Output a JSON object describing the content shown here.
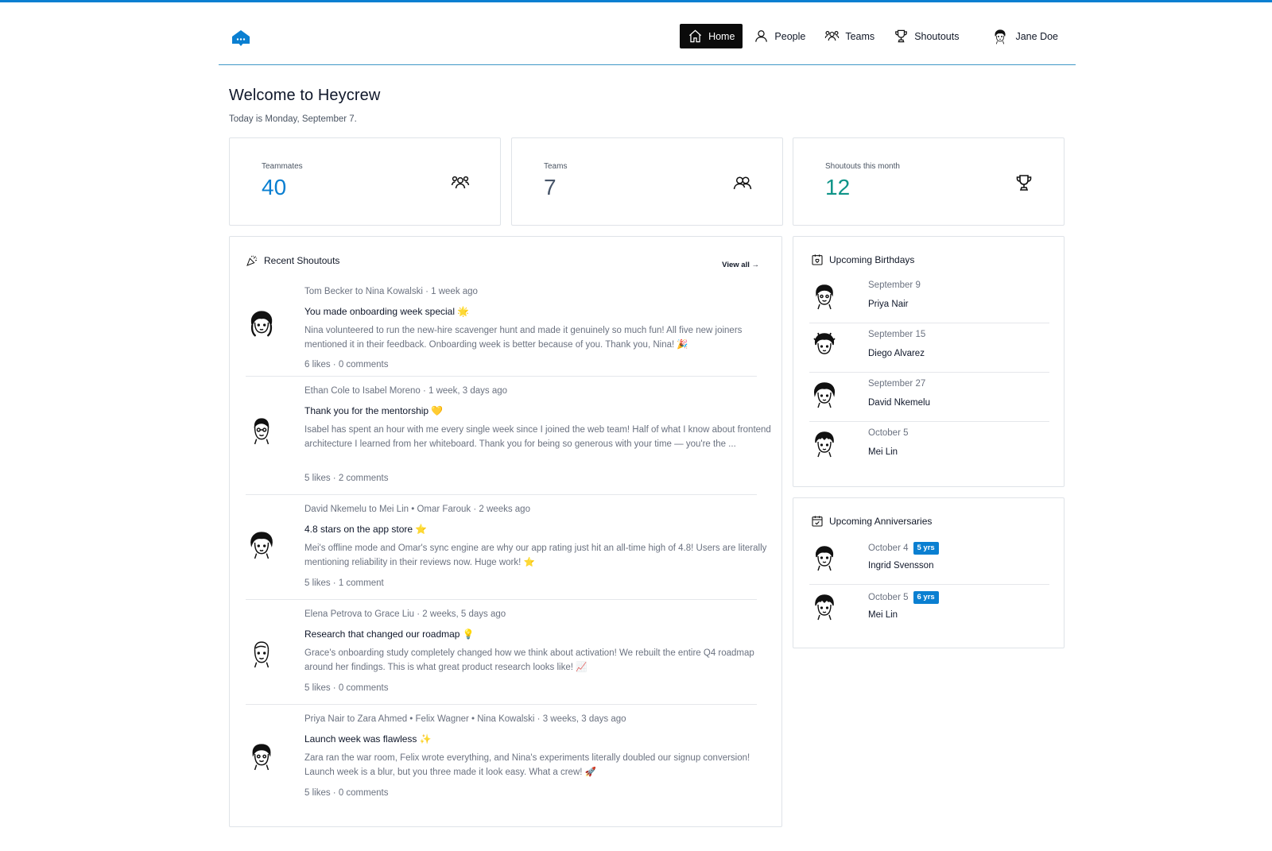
{
  "nav": {
    "items": [
      {
        "label": "Home",
        "icon": "home-icon"
      },
      {
        "label": "People",
        "icon": "person-icon"
      },
      {
        "label": "Teams",
        "icon": "team-icon"
      },
      {
        "label": "Shoutouts",
        "icon": "trophy-icon"
      }
    ],
    "user_name": "Jane Doe"
  },
  "page": {
    "title": "Welcome to Heycrew",
    "subtitle": "Today is Monday, September 7."
  },
  "stats": [
    {
      "label": "Teammates",
      "value": "40",
      "color": "#0a7fd1",
      "icon": "team-icon"
    },
    {
      "label": "Teams",
      "value": "7",
      "color": "#475569",
      "icon": "two-people-icon"
    },
    {
      "label": "Shoutouts this month",
      "value": "12",
      "color": "#0f9488",
      "icon": "trophy-icon"
    }
  ],
  "shoutouts": {
    "title": "Recent Shoutouts",
    "view_all": "View all →",
    "items": [
      {
        "meta": "Tom Becker to Nina Kowalski · 1 week ago",
        "title": "You made onboarding week special 🌟",
        "body": "Nina volunteered to run the new-hire scavenger hunt and made it genuinely so much fun! All five new joiners mentioned it in their feedback. Onboarding week is better because of you. Thank you, Nina! 🎉",
        "stats": "6 likes · 0 comments"
      },
      {
        "meta": "Ethan Cole to Isabel Moreno · 1 week, 3 days ago",
        "title": "Thank you for the mentorship 💛",
        "body": "Isabel has spent an hour with me every single week since I joined the web team! Half of what I know about frontend architecture I learned from her whiteboard. Thank you for being so generous with your time — you're the ...",
        "stats": "5 likes · 2 comments"
      },
      {
        "meta": "David Nkemelu to Mei Lin • Omar Farouk · 2 weeks ago",
        "title": "4.8 stars on the app store ⭐",
        "body": "Mei's offline mode and Omar's sync engine are why our app rating just hit an all-time high of 4.8! Users are literally mentioning reliability in their reviews now. Huge work! ⭐",
        "stats": "5 likes · 1 comment"
      },
      {
        "meta": "Elena Petrova to Grace Liu · 2 weeks, 5 days ago",
        "title": "Research that changed our roadmap 💡",
        "body": "Grace's onboarding study completely changed how we think about activation! We rebuilt the entire Q4 roadmap around her findings. This is what great product research looks like! 📈",
        "stats": "5 likes · 0 comments"
      },
      {
        "meta": "Priya Nair to Zara Ahmed • Felix Wagner • Nina Kowalski · 3 weeks, 3 days ago",
        "title": "Launch week was flawless ✨",
        "body": "Zara ran the war room, Felix wrote everything, and Nina's experiments literally doubled our signup conversion! Launch week is a blur, but you three made it look easy. What a crew! 🚀",
        "stats": "5 likes · 0 comments"
      }
    ]
  },
  "birthdays": {
    "title": "Upcoming Birthdays",
    "items": [
      {
        "date": "September 9",
        "name": "Priya Nair"
      },
      {
        "date": "September 15",
        "name": "Diego Alvarez"
      },
      {
        "date": "September 27",
        "name": "David Nkemelu"
      },
      {
        "date": "October 5",
        "name": "Mei Lin"
      }
    ]
  },
  "anniversaries": {
    "title": "Upcoming Anniversaries",
    "items": [
      {
        "date": "October 4",
        "badge": "5 yrs",
        "name": "Ingrid Svensson"
      },
      {
        "date": "October 5",
        "badge": "6 yrs",
        "name": "Mei Lin"
      }
    ]
  }
}
